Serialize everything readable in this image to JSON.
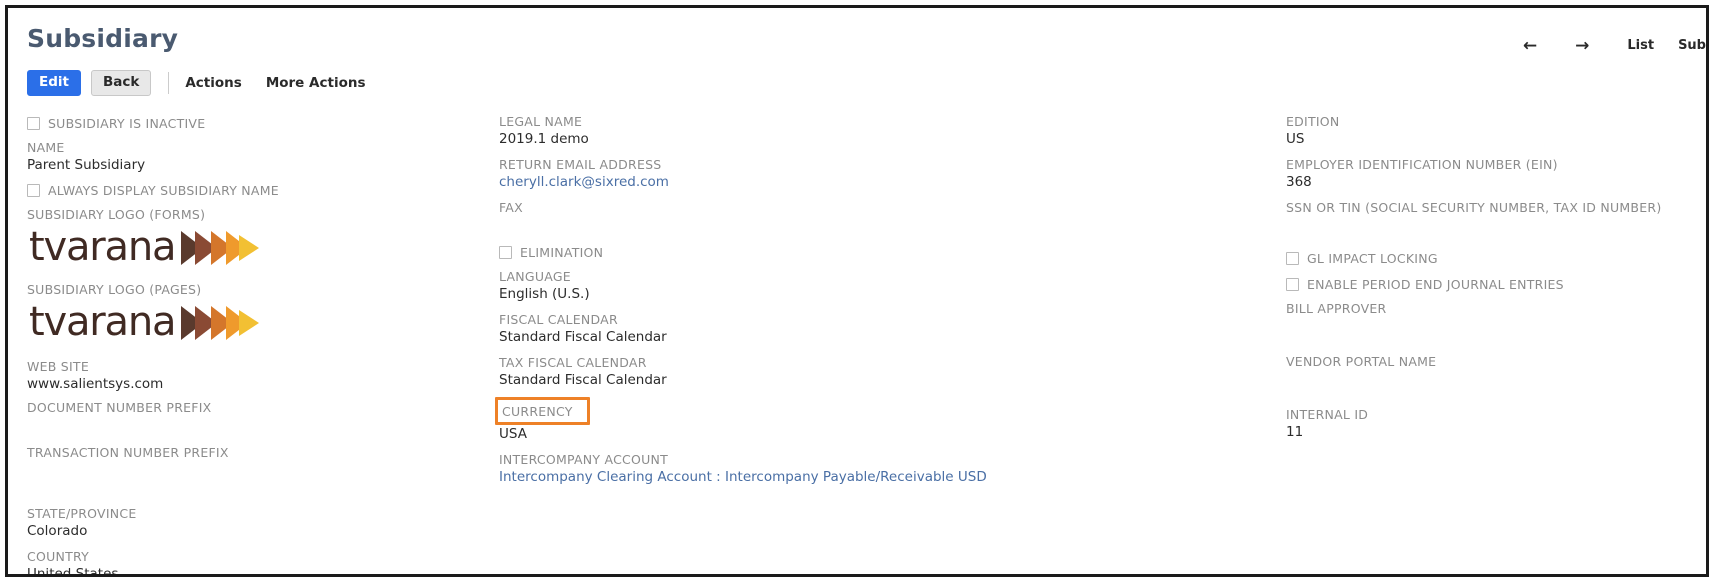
{
  "header": {
    "title": "Subsidiary",
    "buttons": {
      "edit": "Edit",
      "back": "Back"
    },
    "links": [
      "Actions",
      "More Actions"
    ],
    "nav": {
      "prev_icon": "←",
      "next_icon": "→",
      "list_label": "List",
      "sub_label": "Sub"
    }
  },
  "columns": {
    "left": {
      "inactive_checkbox_label": "SUBSIDIARY IS INACTIVE",
      "name_label": "NAME",
      "name_value": "Parent Subsidiary",
      "always_display_label": "ALWAYS DISPLAY SUBSIDIARY NAME",
      "logo_forms_label": "SUBSIDIARY LOGO (FORMS)",
      "logo_forms_text": "tvarana",
      "logo_pages_label": "SUBSIDIARY LOGO (PAGES)",
      "logo_pages_text": "tvarana",
      "web_site_label": "WEB SITE",
      "web_site_value": "www.salientsys.com",
      "document_prefix_label": "DOCUMENT NUMBER PREFIX",
      "document_prefix_value": "",
      "transaction_prefix_label": "TRANSACTION NUMBER PREFIX",
      "transaction_prefix_value": "",
      "state_label": "STATE/PROVINCE",
      "state_value": "Colorado",
      "country_label": "COUNTRY",
      "country_value": "United States"
    },
    "middle": {
      "legal_name_label": "LEGAL NAME",
      "legal_name_value": "2019.1 demo",
      "return_email_label": "RETURN EMAIL ADDRESS",
      "return_email_value": "cheryll.clark@sixred.com",
      "fax_label": "FAX",
      "fax_value": "",
      "elimination_label": "ELIMINATION",
      "language_label": "LANGUAGE",
      "language_value": "English (U.S.)",
      "fiscal_calendar_label": "FISCAL CALENDAR",
      "fiscal_calendar_value": "Standard Fiscal Calendar",
      "tax_fiscal_calendar_label": "TAX FISCAL CALENDAR",
      "tax_fiscal_calendar_value": "Standard Fiscal Calendar",
      "currency_label": "CURRENCY",
      "currency_value": "USA",
      "intercompany_account_label": "INTERCOMPANY ACCOUNT",
      "intercompany_account_value": "Intercompany Clearing Account : Intercompany Payable/Receivable USD"
    },
    "right": {
      "edition_label": "EDITION",
      "edition_value": "US",
      "ein_label": "EMPLOYER IDENTIFICATION NUMBER (EIN)",
      "ein_value": "368",
      "ssn_tin_label": "SSN OR TIN (SOCIAL SECURITY NUMBER, TAX ID NUMBER)",
      "ssn_tin_value": "",
      "gl_impact_locking_label": "GL IMPACT LOCKING",
      "enable_period_end_label": "ENABLE PERIOD END JOURNAL ENTRIES",
      "bill_approver_label": "BILL APPROVER",
      "bill_approver_value": "",
      "vendor_portal_label": "VENDOR PORTAL NAME",
      "vendor_portal_value": "",
      "internal_id_label": "INTERNAL ID",
      "internal_id_value": "11"
    }
  },
  "colors": {
    "primary_button": "#2b6fe8",
    "title": "#4a5a70",
    "label": "#8b8b8b",
    "value": "#2c2c2c",
    "link": "#4a6fa5",
    "highlight": "#ee8127",
    "logo_dark": "#402a23",
    "logo_orange": "#ef8b2c"
  }
}
